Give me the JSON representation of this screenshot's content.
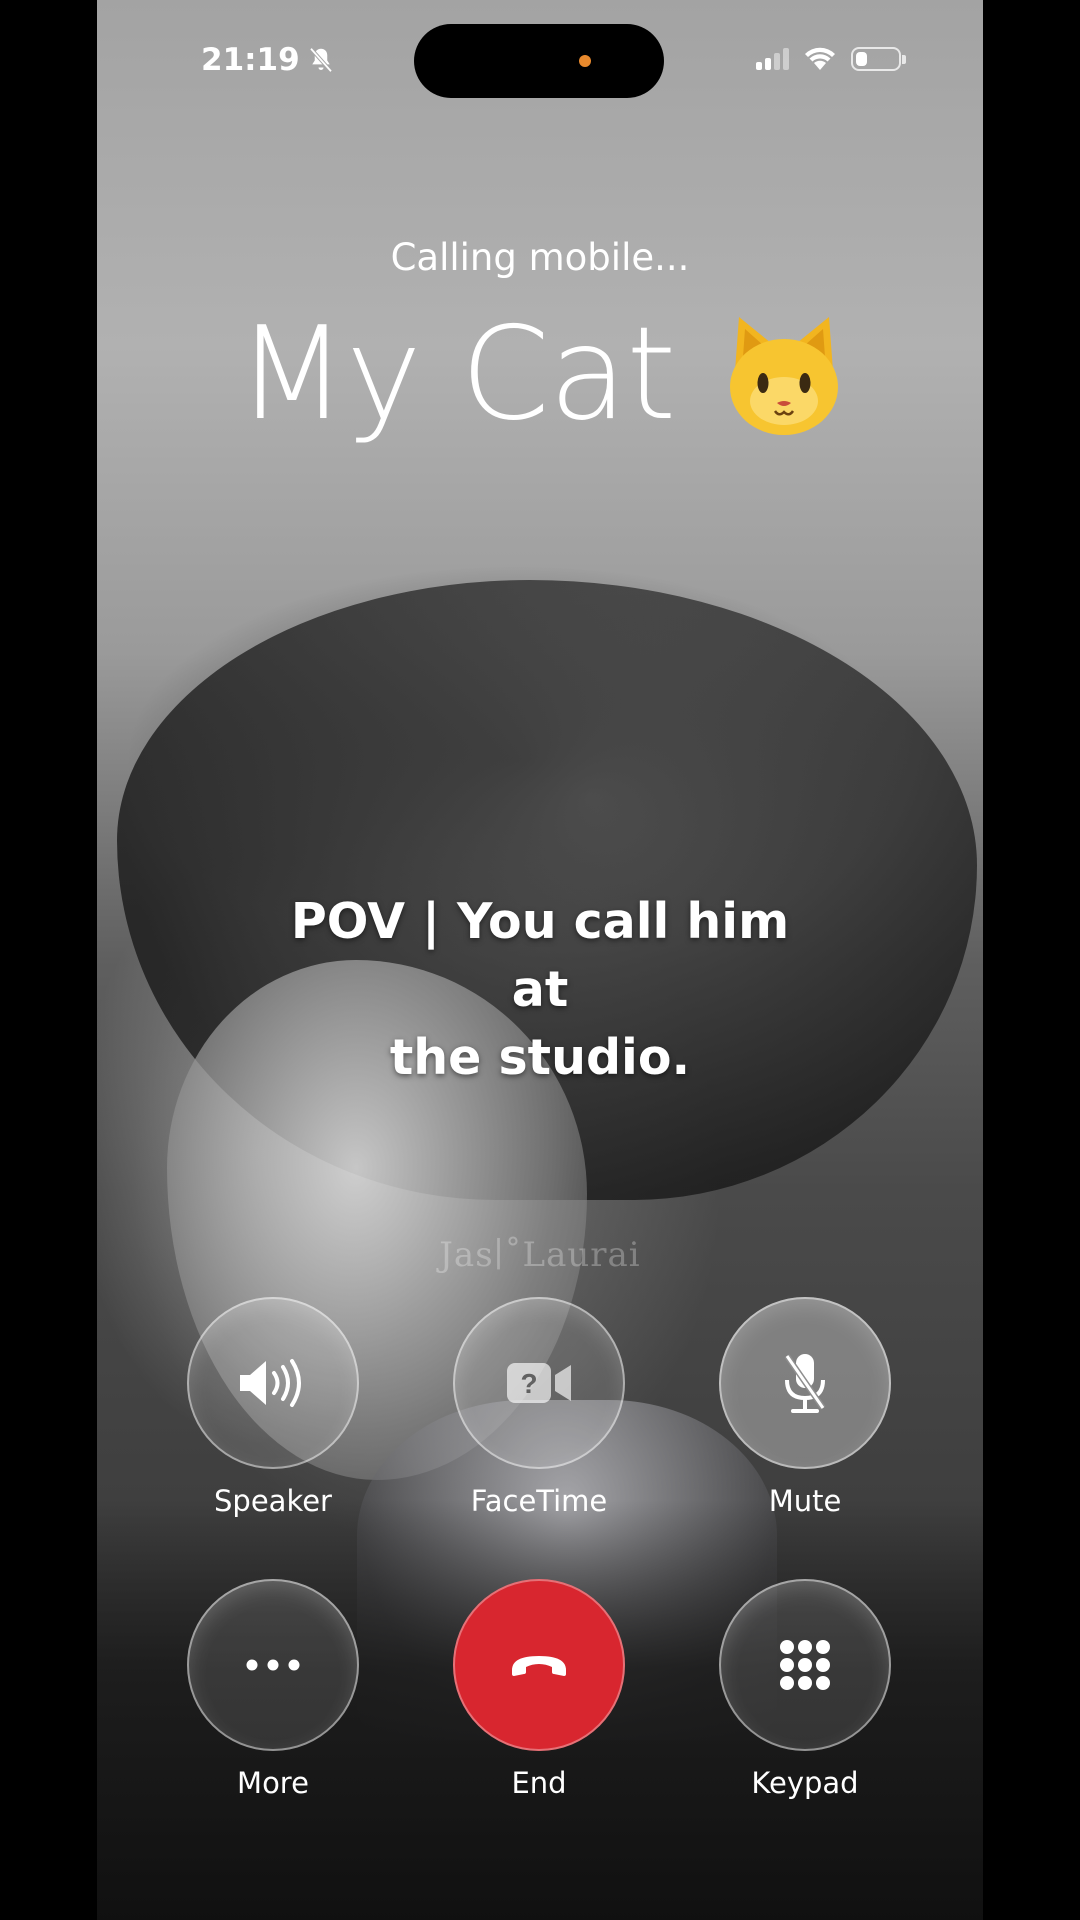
{
  "status_bar": {
    "time": "21:19",
    "battery_level": 0.25
  },
  "call": {
    "status": "Calling mobile...",
    "contact_name": "My Cat",
    "contact_emoji": "cat-face-emoji"
  },
  "overlay": {
    "caption_line1": "POV | You call him at",
    "caption_line2": "the studio.",
    "watermark": "Jas∣˚Laurai"
  },
  "buttons": {
    "speaker": "Speaker",
    "facetime": "FaceTime",
    "mute": "Mute",
    "more": "More",
    "end": "End",
    "keypad": "Keypad"
  },
  "colors": {
    "end_button": "#d8262f",
    "island_indicator": "#e8892d"
  },
  "icons": [
    "bell-slash-icon",
    "signal-icon",
    "wifi-icon",
    "battery-icon",
    "speaker-icon",
    "facetime-icon",
    "mic-slash-icon",
    "more-dots-icon",
    "end-call-icon",
    "keypad-icon"
  ]
}
